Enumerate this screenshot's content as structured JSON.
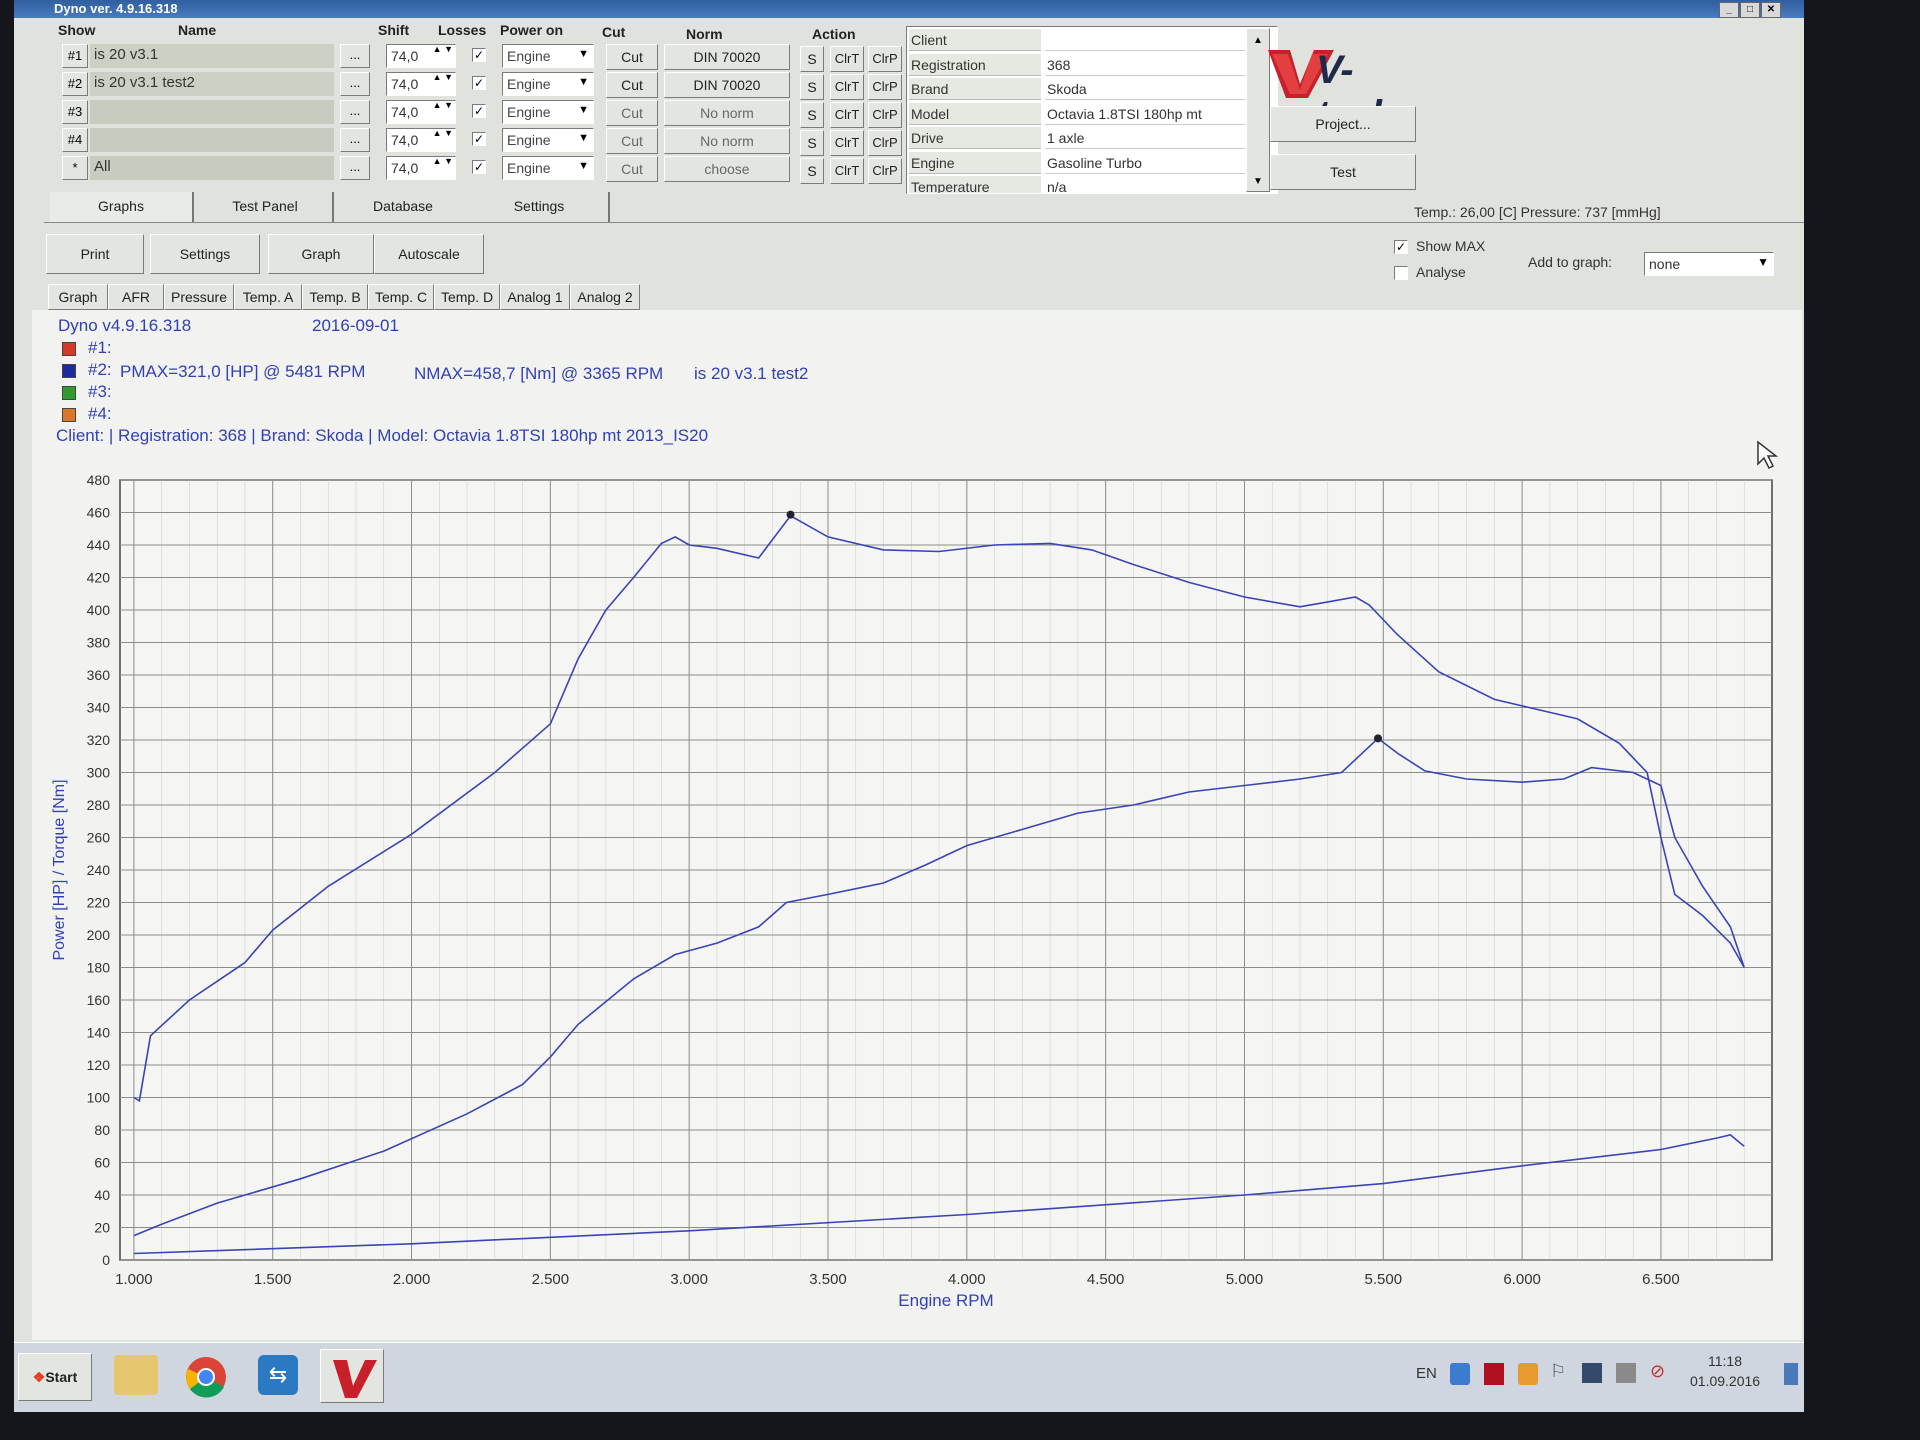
{
  "window": {
    "title": "Dyno ver. 4.9.16.318"
  },
  "top_grid": {
    "headers": {
      "show": "Show",
      "name": "Name",
      "shift": "Shift",
      "losses": "Losses",
      "power_on": "Power on",
      "cut": "Cut",
      "norm": "Norm",
      "action": "Action"
    },
    "rows": [
      {
        "show": "#1",
        "name": "is 20 v3.1",
        "shift": "74,0",
        "power_on": "Engine",
        "cut": "Cut",
        "norm": "DIN 70020"
      },
      {
        "show": "#2",
        "name": "is 20 v3.1 test2",
        "shift": "74,0",
        "power_on": "Engine",
        "cut": "Cut",
        "norm": "DIN 70020"
      },
      {
        "show": "#3",
        "name": "",
        "shift": "74,0",
        "power_on": "Engine",
        "cut": "Cut",
        "norm": "No norm"
      },
      {
        "show": "#4",
        "name": "",
        "shift": "74,0",
        "power_on": "Engine",
        "cut": "Cut",
        "norm": "No norm"
      },
      {
        "show": "*",
        "name": "All",
        "shift": "74,0",
        "power_on": "Engine",
        "cut": "Cut",
        "norm": "choose"
      }
    ],
    "dots_label": "...",
    "action_labels": {
      "s": "S",
      "clrt": "ClrT",
      "clrp": "ClrP"
    }
  },
  "info_panel": {
    "rows": [
      {
        "key": "Client",
        "value": ""
      },
      {
        "key": "Registration",
        "value": "368"
      },
      {
        "key": "Brand",
        "value": "Skoda"
      },
      {
        "key": "Model",
        "value": "Octavia 1.8TSI 180hp mt"
      },
      {
        "key": "Drive",
        "value": "1 axle"
      },
      {
        "key": "Engine",
        "value": "Gasoline Turbo"
      },
      {
        "key": "Temperature",
        "value": "n/a"
      }
    ]
  },
  "logo_text": "V-tech",
  "project_button": "Project...",
  "test_button": "Test",
  "tabs": [
    "Graphs",
    "Test Panel",
    "Database",
    "Settings"
  ],
  "status": "Temp.: 26,00 [C]  Pressure: 737 [mmHg]",
  "toolbar": {
    "print": "Print",
    "settings": "Settings",
    "graph": "Graph",
    "autoscale": "Autoscale"
  },
  "options": {
    "show_max": "Show MAX",
    "show_max_checked": true,
    "analyse": "Analyse",
    "analyse_checked": false,
    "add_to_graph_label": "Add to graph:",
    "add_to_graph_value": "none"
  },
  "subtabs": [
    "Graph",
    "AFR",
    "Pressure",
    "Temp. A",
    "Temp. B",
    "Temp. C",
    "Temp. D",
    "Analog 1",
    "Analog 2"
  ],
  "plot_header": {
    "version": "Dyno v4.9.16.318",
    "date": "2016-09-01",
    "legend": [
      {
        "label": "#1:",
        "color": "#d23a2a"
      },
      {
        "label": "#2:",
        "color": "#1c2a9c",
        "pmax": "PMAX=321,0 [HP] @ 5481 RPM",
        "nmax": "NMAX=458,7 [Nm] @ 3365 RPM",
        "name": "is 20 v3.1 test2"
      },
      {
        "label": "#3:",
        "color": "#2e9c2e"
      },
      {
        "label": "#4:",
        "color": "#d8782a"
      }
    ],
    "client_line": "Client:   | Registration: 368 | Brand: Skoda | Model: Octavia 1.8TSI 180hp mt 2013_IS20"
  },
  "chart_data": {
    "type": "line",
    "xlabel": "Engine RPM",
    "ylabel": "Power [HP] / Torque [Nm]",
    "xlim": [
      950,
      6900
    ],
    "ylim": [
      0,
      480
    ],
    "x_ticks": [
      "1.000",
      "1.500",
      "2.000",
      "2.500",
      "3.000",
      "3.500",
      "4.000",
      "4.500",
      "5.000",
      "5.500",
      "6.000",
      "6.500"
    ],
    "y_ticks": [
      "0",
      "20",
      "40",
      "60",
      "80",
      "100",
      "120",
      "140",
      "160",
      "180",
      "200",
      "220",
      "240",
      "260",
      "280",
      "300",
      "320",
      "340",
      "360",
      "380",
      "400",
      "420",
      "440",
      "460",
      "480"
    ],
    "line_color": "#3a44b4",
    "series": [
      {
        "x": [
          1000,
          1020,
          1060,
          1200,
          1400,
          1500,
          1700,
          2000,
          2300,
          2500,
          2600,
          2700,
          2800,
          2900,
          2950,
          3000,
          3100,
          3250,
          3365,
          3500,
          3700,
          3900,
          4100,
          4300,
          4450,
          4600,
          4800,
          5000,
          5200,
          5300,
          5400,
          5450,
          5550,
          5700,
          5900,
          6100,
          6200,
          6350,
          6450,
          6500,
          6550,
          6650,
          6750,
          6800
        ],
        "y": [
          100,
          98,
          138,
          160,
          183,
          203,
          230,
          262,
          300,
          330,
          370,
          400,
          420,
          441,
          445,
          440,
          438,
          432,
          458,
          445,
          437,
          436,
          440,
          441,
          437,
          428,
          417,
          408,
          402,
          405,
          408,
          403,
          385,
          362,
          345,
          337,
          333,
          318,
          300,
          260,
          225,
          212,
          195,
          180
        ]
      },
      {
        "x": [
          1000,
          1100,
          1300,
          1600,
          1900,
          2200,
          2400,
          2500,
          2600,
          2800,
          2950,
          3100,
          3250,
          3350,
          3500,
          3700,
          3850,
          4000,
          4200,
          4400,
          4600,
          4800,
          5000,
          5200,
          5350,
          5481,
          5550,
          5650,
          5800,
          6000,
          6150,
          6250,
          6400,
          6500,
          6550,
          6650,
          6750,
          6800
        ],
        "y": [
          15,
          22,
          35,
          50,
          67,
          90,
          108,
          125,
          145,
          173,
          188,
          195,
          205,
          220,
          225,
          232,
          243,
          255,
          265,
          275,
          280,
          288,
          292,
          296,
          300,
          321,
          312,
          301,
          296,
          294,
          296,
          303,
          300,
          292,
          260,
          230,
          205,
          180
        ]
      },
      {
        "x": [
          1000,
          2000,
          3000,
          4000,
          5000,
          5500,
          6000,
          6500,
          6700,
          6750,
          6800
        ],
        "y": [
          4,
          10,
          18,
          28,
          40,
          47,
          58,
          68,
          75,
          77,
          70
        ]
      }
    ],
    "markers": [
      {
        "x": 3365,
        "y": 458.7
      },
      {
        "x": 5481,
        "y": 321.0
      }
    ],
    "grid": true
  },
  "taskbar": {
    "start": "Start",
    "lang": "EN",
    "time": "11:18",
    "date": "01.09.2016"
  }
}
